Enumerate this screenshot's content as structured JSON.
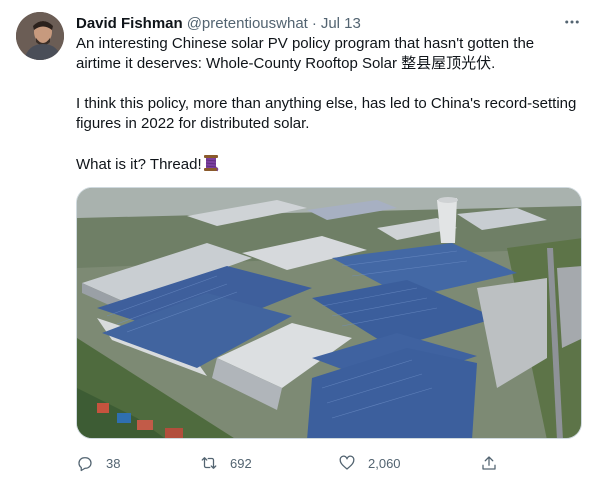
{
  "tweet": {
    "author_name": "David Fishman",
    "author_handle": "@pretentiouswhat",
    "separator": "·",
    "date": "Jul 13",
    "text_line1": "An interesting Chinese solar PV policy program that hasn't gotten the airtime it deserves: Whole-County Rooftop Solar 整县屋顶光伏.",
    "text_line2": "I think this policy, more than anything else, has led to China's record-setting figures in 2022 for distributed solar.",
    "text_line3": "What is it? Thread!",
    "thread_emoji_icon": "spool-of-thread-icon",
    "image_subject": "aerial view of industrial park with rooftop solar panels and cooling tower"
  },
  "actions": {
    "reply_count": "38",
    "retweet_count": "692",
    "like_count": "2,060"
  },
  "icons": {
    "more": "more-horizontal-icon",
    "reply": "reply-icon",
    "retweet": "retweet-icon",
    "like": "heart-icon",
    "share": "share-icon"
  },
  "colors": {
    "text": "#0f1419",
    "muted": "#536471",
    "border": "#cfd9de",
    "solar_panel": "#3e5f9c"
  }
}
